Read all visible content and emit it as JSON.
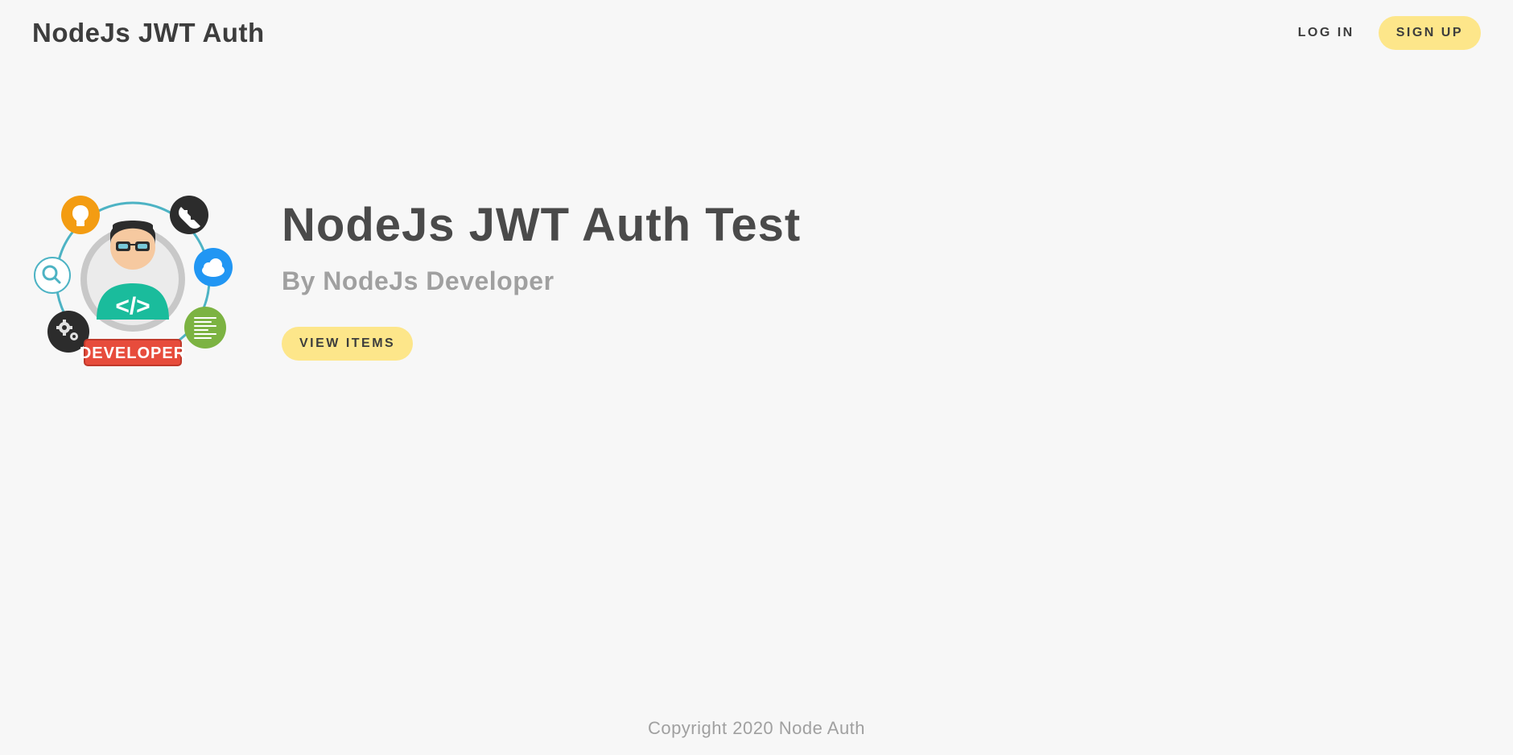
{
  "header": {
    "logo": "NodeJs JWT Auth",
    "login_label": "LOG IN",
    "signup_label": "SIGN UP"
  },
  "hero": {
    "title": "NodeJs JWT Auth Test",
    "subtitle": "By NodeJs Developer",
    "button_label": "VIEW ITEMS",
    "badge_text": "DEVELOPER"
  },
  "footer": {
    "text": "Copyright 2020 Node Auth"
  },
  "colors": {
    "accent": "#fde68a",
    "text_dark": "#3d3d3d",
    "text_muted": "#a0a0a0",
    "background": "#f7f7f7"
  }
}
